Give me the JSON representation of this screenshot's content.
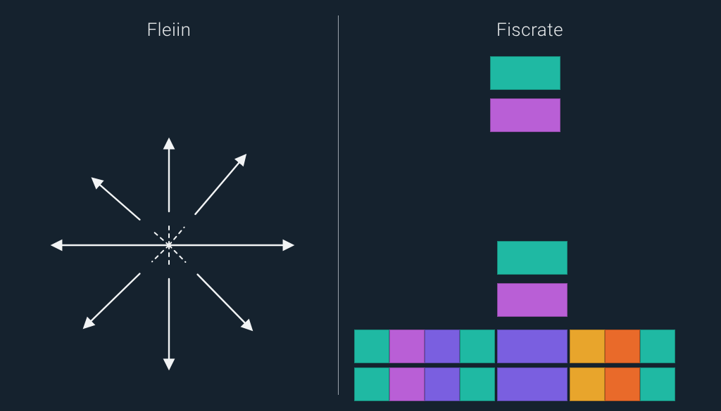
{
  "left": {
    "title": "Fleiin",
    "diagram": {
      "type": "star-arrows",
      "description": "Eight arrows radiating outward from a common center, with short dashed segments near the center on vertical and diagonal axes.",
      "directions": [
        "N",
        "NE",
        "E",
        "SE",
        "S",
        "SW",
        "W",
        "NW"
      ],
      "stroke_color": "#f2f4f5",
      "dashed_center": true
    }
  },
  "right": {
    "title": "Fiscrate",
    "blocks": {
      "unit_w": 50,
      "unit_h": 48,
      "row_gap": 6,
      "group_gap": 28,
      "top_stack": [
        {
          "color": "teal"
        },
        {
          "color": "magenta"
        }
      ],
      "mid_stack": [
        {
          "color": "teal"
        },
        {
          "color": "magenta"
        }
      ],
      "bottom_groups": [
        {
          "rows": [
            [
              "teal",
              "magenta",
              "purple",
              "teal"
            ],
            [
              "teal",
              "magenta",
              "purple",
              "teal"
            ]
          ]
        },
        {
          "rows": [
            [
              "purple"
            ],
            [
              "purple"
            ]
          ]
        },
        {
          "rows": [
            [
              "amber",
              "orange",
              "teal"
            ],
            [
              "amber",
              "orange",
              "teal"
            ]
          ]
        }
      ]
    }
  },
  "palette": {
    "teal": "#1fb9a3",
    "magenta": "#b95fd6",
    "purple": "#7a5fe0",
    "amber": "#e8a52c",
    "orange": "#e96a2a",
    "bg": "#15222e",
    "fg": "#f2f4f5"
  }
}
